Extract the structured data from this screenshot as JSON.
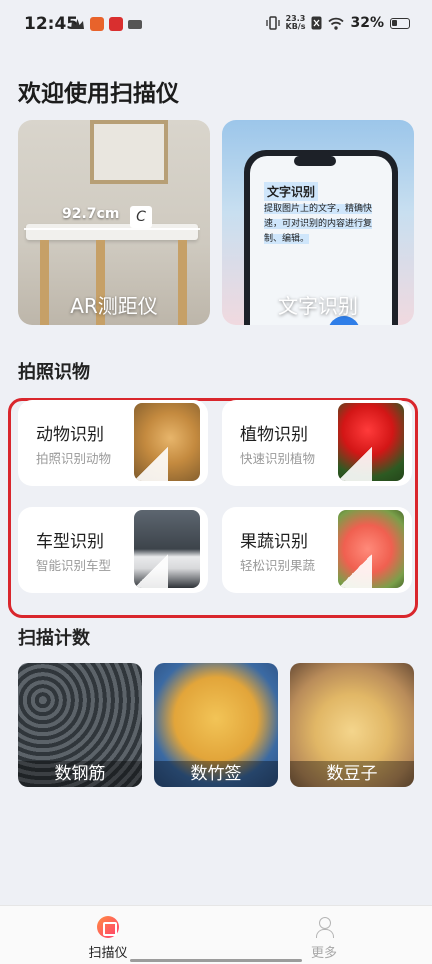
{
  "status_bar": {
    "time": "12:45",
    "net_speed": "23.3",
    "net_unit": "KB/s",
    "battery": "32%"
  },
  "page_title": "欢迎使用扫描仪",
  "hero": {
    "ar": {
      "label": "AR测距仪",
      "measure": "92.7cm",
      "cup_letter": "C"
    },
    "ocr": {
      "label": "文字识别",
      "sample_title": "文字识别",
      "sample_text": "提取图片上的文字，精确快速，可对识别的内容进行复制、编辑。"
    }
  },
  "sections": {
    "photo_recognition": "拍照识物",
    "scan_count": "扫描计数"
  },
  "recognition_cards": [
    {
      "name": "动物识别",
      "desc": "拍照识别动物",
      "thumb": "dog-photo"
    },
    {
      "name": "植物识别",
      "desc": "快速识别植物",
      "thumb": "tulip-photo"
    },
    {
      "name": "车型识别",
      "desc": "智能识别车型",
      "thumb": "car-photo"
    },
    {
      "name": "果蔬识别",
      "desc": "轻松识别果蔬",
      "thumb": "peach-photo"
    }
  ],
  "count_cards": [
    {
      "label": "数钢筋",
      "thumb": "rebar-photo"
    },
    {
      "label": "数竹签",
      "thumb": "bamboo-skewer-photo"
    },
    {
      "label": "数豆子",
      "thumb": "soybean-photo"
    }
  ],
  "bottom_nav": {
    "scanner": "扫描仪",
    "more": "更多"
  },
  "colors": {
    "background": "#eef0f5",
    "highlight_frame": "#d9262c",
    "accent_gradient_start": "#ff8c42",
    "accent_gradient_end": "#ff3d6f"
  }
}
